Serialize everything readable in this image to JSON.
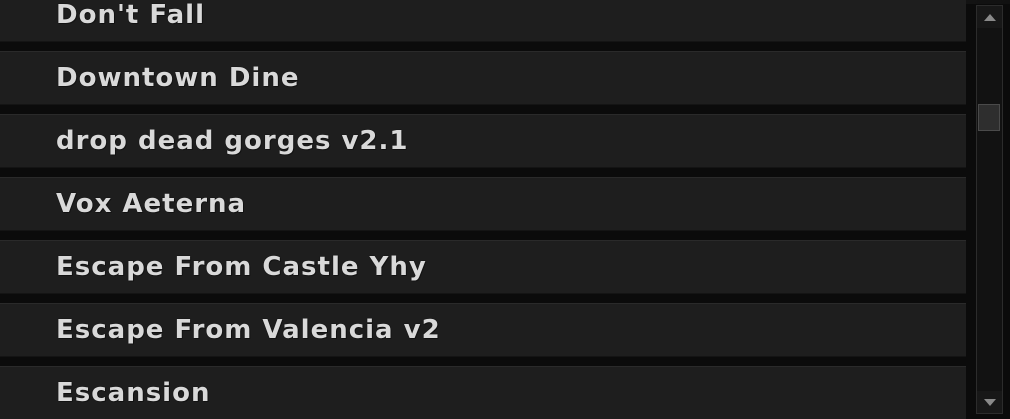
{
  "list": {
    "items": [
      {
        "label": "Don't Fall"
      },
      {
        "label": "Downtown Dine"
      },
      {
        "label": "drop dead gorges v2.1"
      },
      {
        "label": "Vox Aeterna"
      },
      {
        "label": "Escape From Castle Yhy"
      },
      {
        "label": "Escape From Valencia v2"
      },
      {
        "label": "Escansion"
      }
    ]
  },
  "scrollbar": {
    "position_fraction": 0.25
  },
  "colors": {
    "background": "#0b0b0b",
    "row": "#1e1e1e",
    "text": "#d9d9d9",
    "scrollbar_track": "#121212",
    "scrollbar_thumb": "#2e2e2e"
  },
  "icons": {
    "scroll_up": "triangle-up-icon",
    "scroll_down": "triangle-down-icon"
  }
}
